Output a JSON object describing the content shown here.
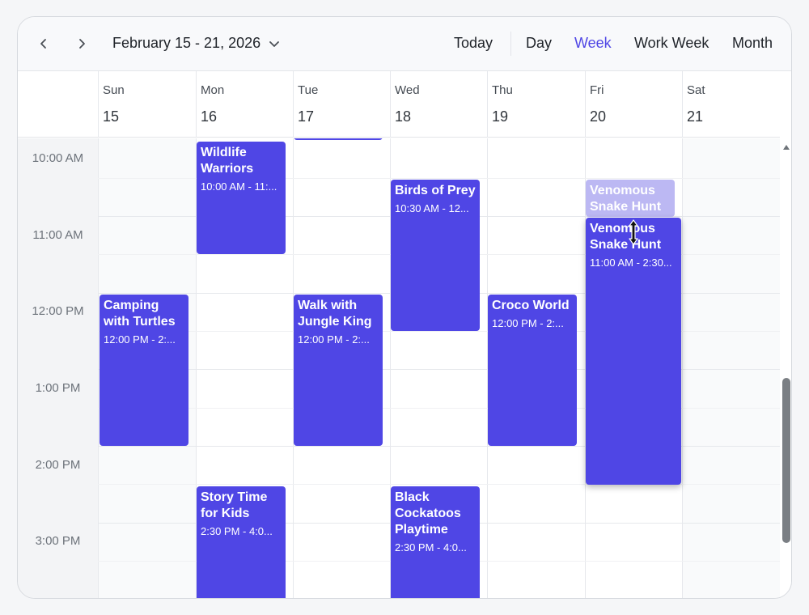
{
  "toolbar": {
    "date_range": "February 15 - 21, 2026",
    "views": [
      "Today",
      "Day",
      "Week",
      "Work Week",
      "Month"
    ],
    "active_view": "Week"
  },
  "days": [
    {
      "name": "Sun",
      "num": "15"
    },
    {
      "name": "Mon",
      "num": "16"
    },
    {
      "name": "Tue",
      "num": "17"
    },
    {
      "name": "Wed",
      "num": "18"
    },
    {
      "name": "Thu",
      "num": "19"
    },
    {
      "name": "Fri",
      "num": "20"
    },
    {
      "name": "Sat",
      "num": "21"
    }
  ],
  "time_labels": [
    "10:00 AM",
    "11:00 AM",
    "12:00 PM",
    "1:00 PM",
    "2:00 PM",
    "3:00 PM"
  ],
  "events": [
    {
      "title": "",
      "time": ""
    },
    {
      "title": "Wildlife Warriors",
      "time": "10:00 AM - 11:..."
    },
    {
      "title": "Birds of Prey",
      "time": "10:30 AM - 12..."
    },
    {
      "title": "Venomous Snake Hunt",
      "time": ""
    },
    {
      "title": "Venomous Snake Hunt",
      "time": "11:00 AM - 2:30..."
    },
    {
      "title": "Camping with Turtles",
      "time": "12:00 PM - 2:..."
    },
    {
      "title": "Walk with Jungle King",
      "time": "12:00 PM - 2:..."
    },
    {
      "title": "Croco World",
      "time": "12:00 PM - 2:..."
    },
    {
      "title": "Story Time for Kids",
      "time": "2:30 PM - 4:0..."
    },
    {
      "title": "Black Cockatoos Playtime",
      "time": "2:30 PM - 4:0..."
    }
  ],
  "colors": {
    "event": "#4f46e5",
    "event_ghost": "#bcb8f3",
    "active_view": "#4f46e5"
  },
  "icons": {
    "prev": "chevron-left-icon",
    "next": "chevron-right-icon",
    "dropdown": "chevron-down-icon",
    "scroll_up": "triangle-up-icon",
    "cursor": "resize-vertical-cursor-icon"
  }
}
